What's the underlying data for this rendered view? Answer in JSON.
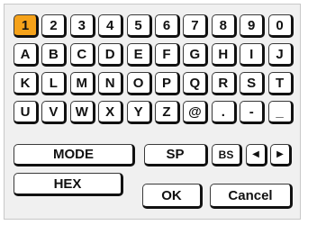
{
  "keyboard": {
    "rows": [
      [
        "1",
        "2",
        "3",
        "4",
        "5",
        "6",
        "7",
        "8",
        "9",
        "0"
      ],
      [
        "A",
        "B",
        "C",
        "D",
        "E",
        "F",
        "G",
        "H",
        "I",
        "J"
      ],
      [
        "K",
        "L",
        "M",
        "N",
        "O",
        "P",
        "Q",
        "R",
        "S",
        "T"
      ],
      [
        "U",
        "V",
        "W",
        "X",
        "Y",
        "Z",
        "@",
        ".",
        "-",
        "_"
      ]
    ],
    "selected": "1"
  },
  "buttons": {
    "mode": "MODE",
    "sp": "SP",
    "bs": "BS",
    "hex": "HEX",
    "ok": "OK",
    "cancel": "Cancel"
  },
  "icons": {
    "left": "left-arrow-icon",
    "right": "right-arrow-icon"
  },
  "colors": {
    "selected_key": "#f5a21a"
  }
}
